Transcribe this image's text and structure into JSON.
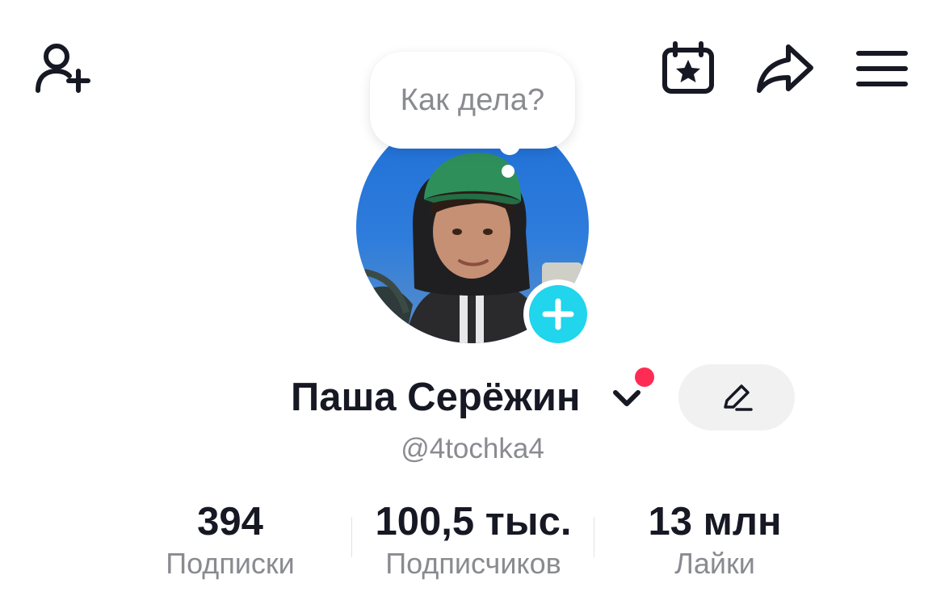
{
  "header": {
    "icons": [
      "add-friend-icon",
      "calendar-star-icon",
      "share-icon",
      "menu-icon"
    ]
  },
  "profile": {
    "bubble_text": "Как дела?",
    "name": "Паша Серёжин",
    "username": "@4tochka4",
    "notification_dot_color": "#fe2c55",
    "plus_badge_color": "#20d5ec"
  },
  "stats": [
    {
      "value": "394",
      "label": "Подписки"
    },
    {
      "value": "100,5 тыс.",
      "label": "Подписчиков"
    },
    {
      "value": "13 млн",
      "label": "Лайки"
    }
  ]
}
